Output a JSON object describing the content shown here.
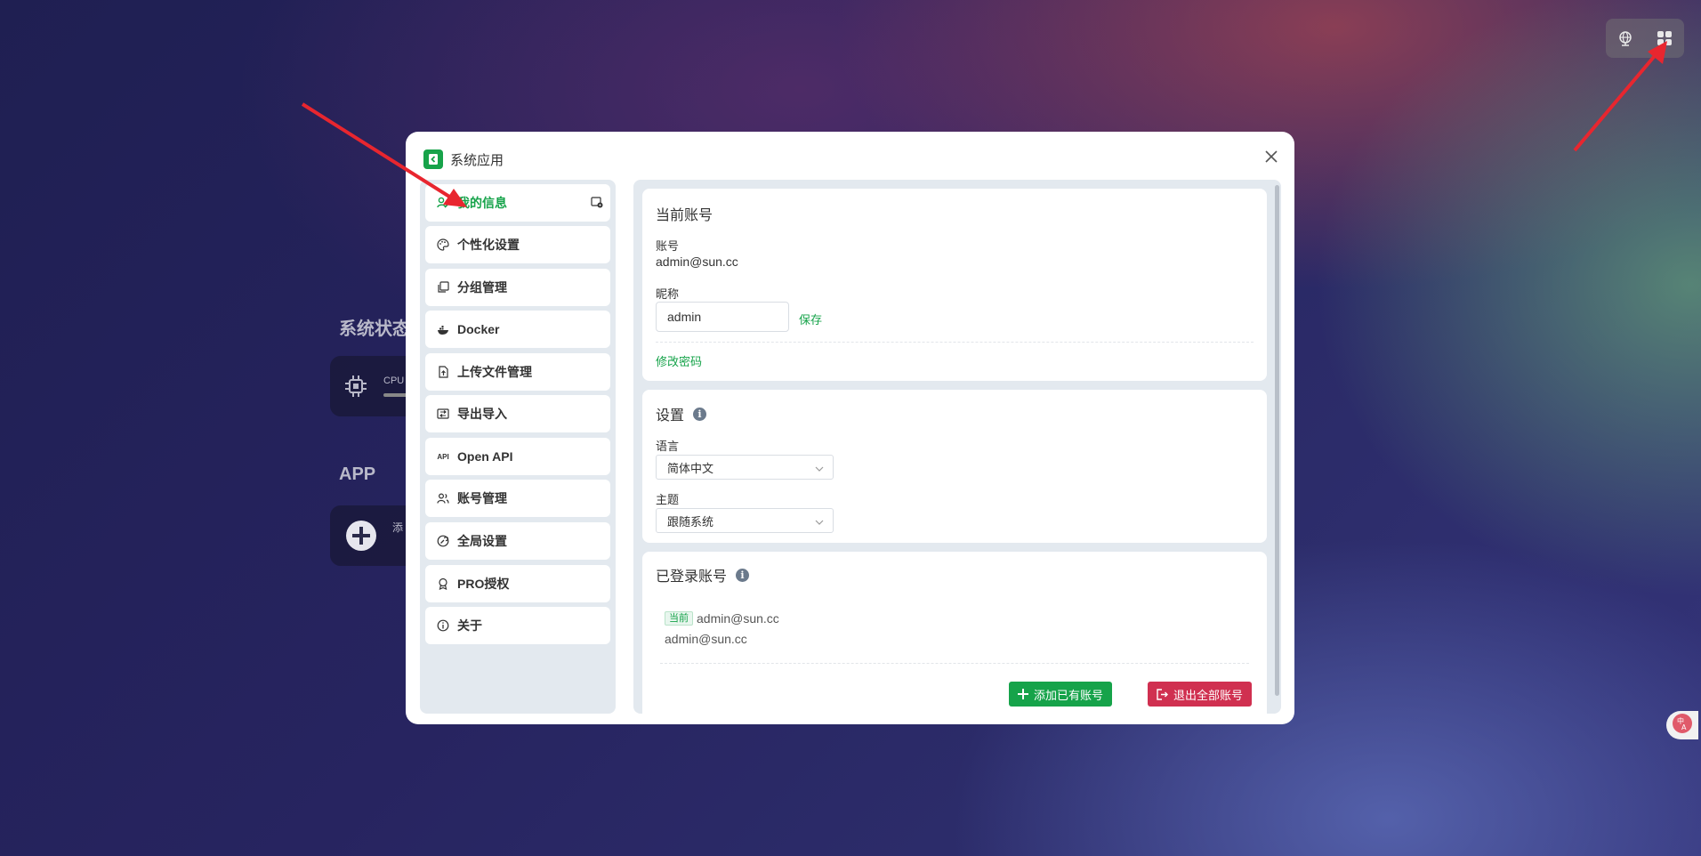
{
  "background": {
    "section_status": "系统状态",
    "cpu_label": "CPU",
    "section_app": "APP",
    "app_add_label": "添"
  },
  "modal": {
    "title": "系统应用",
    "sidebar": {
      "items": [
        {
          "label": "我的信息",
          "icon": "user-edit-icon",
          "active": true
        },
        {
          "label": "个性化设置",
          "icon": "palette-icon"
        },
        {
          "label": "分组管理",
          "icon": "copy-stack-icon"
        },
        {
          "label": "Docker",
          "icon": "docker-whale-icon"
        },
        {
          "label": "上传文件管理",
          "icon": "file-upload-icon"
        },
        {
          "label": "导出导入",
          "icon": "swap-icon"
        },
        {
          "label": "Open API",
          "icon": "api-icon"
        },
        {
          "label": "账号管理",
          "icon": "users-icon"
        },
        {
          "label": "全局设置",
          "icon": "global-settings-icon"
        },
        {
          "label": "PRO授权",
          "icon": "award-icon"
        },
        {
          "label": "关于",
          "icon": "info-circle-icon"
        }
      ]
    },
    "current_account": {
      "title": "当前账号",
      "account_label": "账号",
      "account_value": "admin@sun.cc",
      "nickname_label": "昵称",
      "nickname_value": "admin",
      "save_link": "保存",
      "change_password_link": "修改密码"
    },
    "settings": {
      "title": "设置",
      "language_label": "语言",
      "language_value": "简体中文",
      "theme_label": "主题",
      "theme_value": "跟随系统"
    },
    "logged_accounts": {
      "title": "已登录账号",
      "current_tag": "当前",
      "accounts": [
        "admin@sun.cc",
        "admin@sun.cc"
      ],
      "add_button": "添加已有账号",
      "logout_all_button": "退出全部账号"
    }
  },
  "colors": {
    "accent_green": "#16a34a",
    "danger_red": "#d03050",
    "annotation_arrow": "#e8262f"
  }
}
